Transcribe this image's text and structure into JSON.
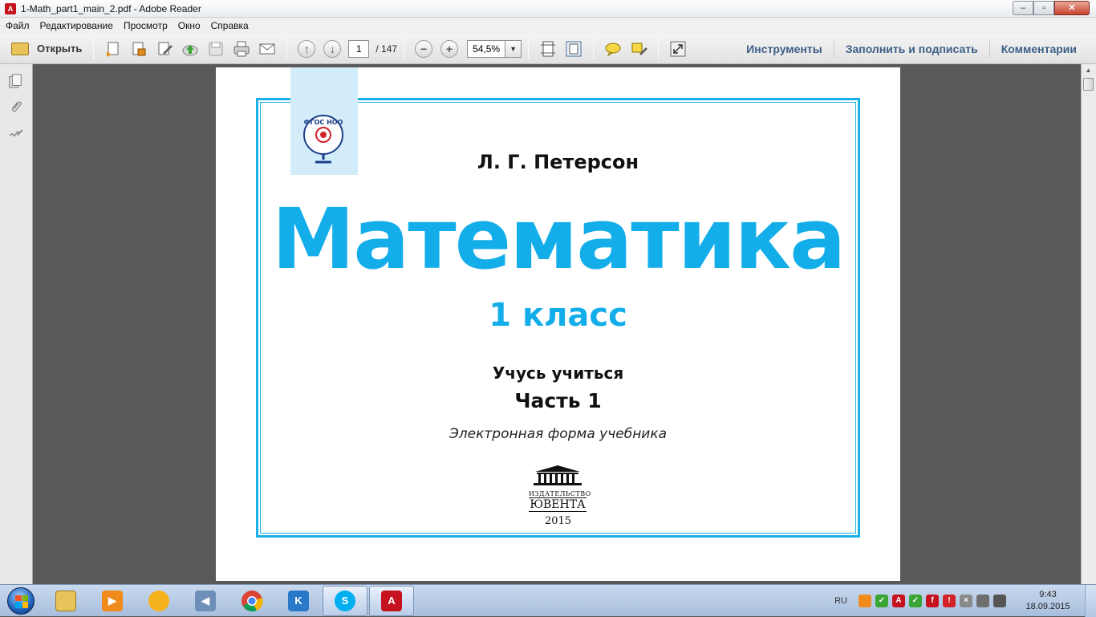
{
  "window": {
    "title": "1-Math_part1_main_2.pdf - Adobe Reader",
    "controls": {
      "minimize": "–",
      "maximize": "▫",
      "close": "✕"
    }
  },
  "menu": [
    "Файл",
    "Редактирование",
    "Просмотр",
    "Окно",
    "Справка"
  ],
  "toolbar": {
    "open_label": "Открыть",
    "current_page": "1",
    "page_count": "/ 147",
    "zoom": "54,5%",
    "right_links": [
      "Инструменты",
      "Заполнить и подписать",
      "Комментарии"
    ]
  },
  "document": {
    "badge_text": "ФГОС НОО",
    "author": "Л. Г. Петерсон",
    "subject": "Математика",
    "grade": "1 класс",
    "series": "Учусь учиться",
    "part": "Часть 1",
    "form": "Электронная форма учебника",
    "publisher_small": "ИЗДАТЕЛЬСТВО",
    "publisher_name": "ЮВЕНТА",
    "year": "2015",
    "accent_color": "#13aeea"
  },
  "taskbar": {
    "language": "RU",
    "time": "9:43",
    "date": "18.09.2015",
    "apps": [
      "windows-explorer",
      "media-player",
      "messenger",
      "volume-app",
      "chrome",
      "kodi",
      "skype",
      "adobe-reader"
    ]
  }
}
